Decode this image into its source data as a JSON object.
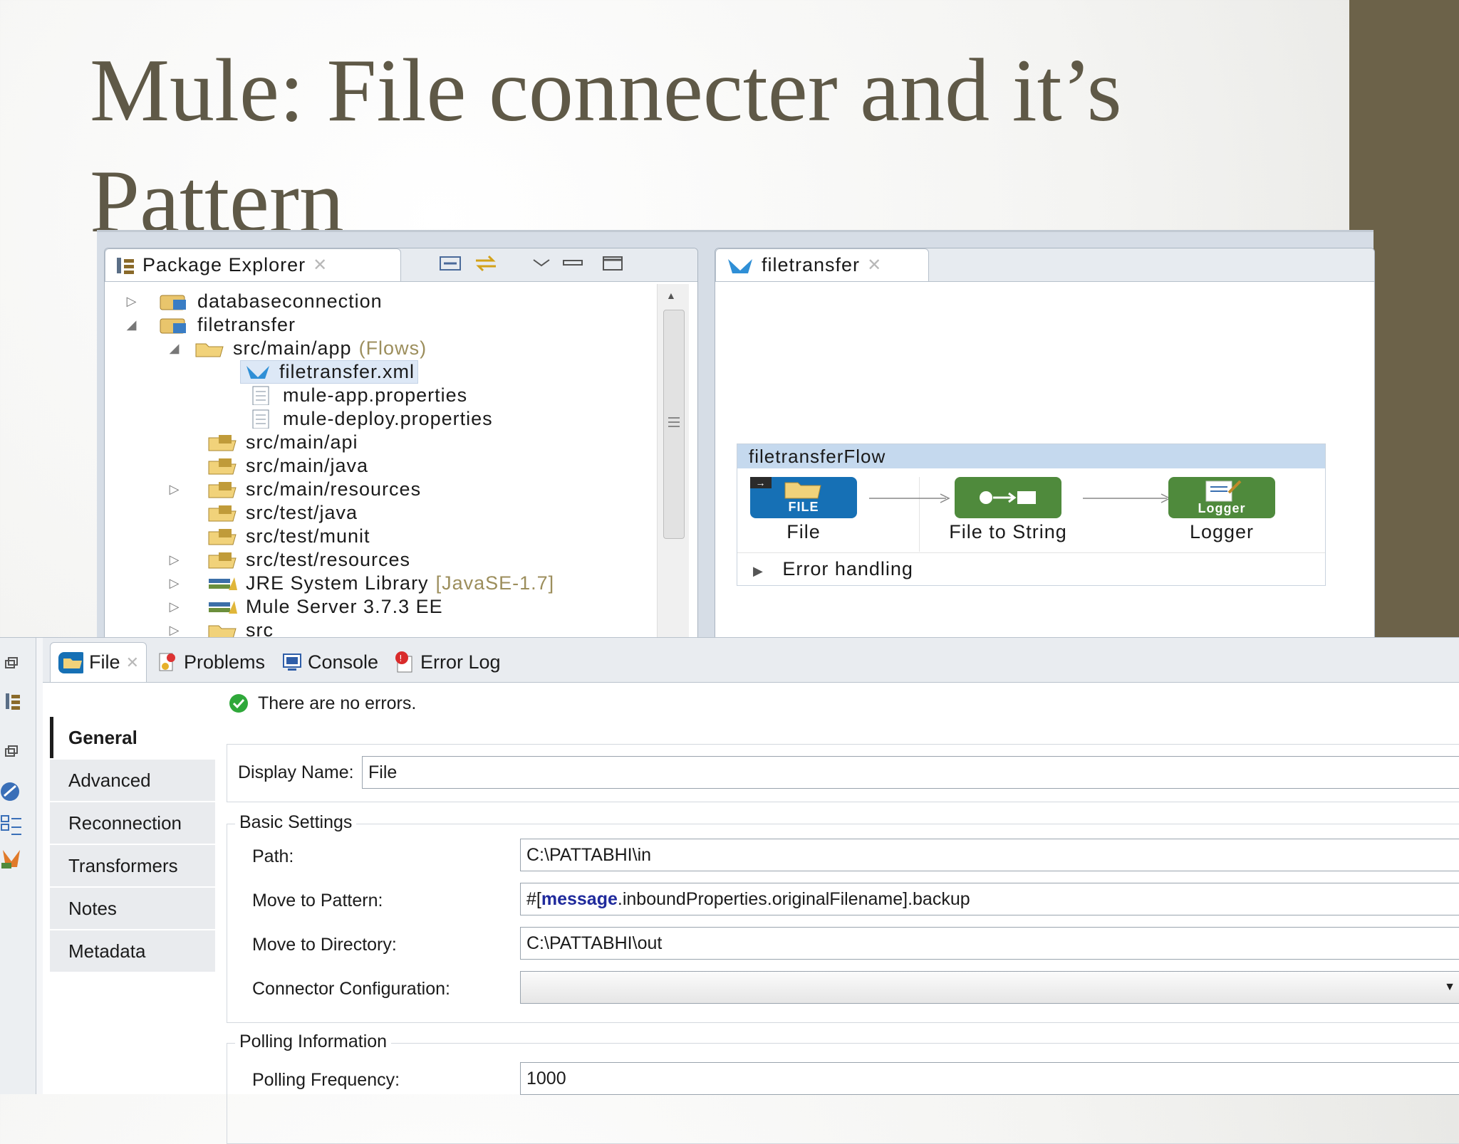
{
  "slide": {
    "title_line1": "Mule: File connecter and it’s",
    "title_line2": "Pattern"
  },
  "package_explorer": {
    "tab_label": "Package Explorer",
    "tree": [
      {
        "label": "databaseconnection",
        "suffix": ""
      },
      {
        "label": "filetransfer",
        "suffix": ""
      },
      {
        "label": "src/main/app",
        "suffix": "(Flows)"
      },
      {
        "label": "filetransfer.xml",
        "suffix": ""
      },
      {
        "label": "mule-app.properties",
        "suffix": ""
      },
      {
        "label": "mule-deploy.properties",
        "suffix": ""
      },
      {
        "label": "src/main/api",
        "suffix": ""
      },
      {
        "label": "src/main/java",
        "suffix": ""
      },
      {
        "label": "src/main/resources",
        "suffix": ""
      },
      {
        "label": "src/test/java",
        "suffix": ""
      },
      {
        "label": "src/test/munit",
        "suffix": ""
      },
      {
        "label": "src/test/resources",
        "suffix": ""
      },
      {
        "label": "JRE System Library",
        "suffix": "[JavaSE-1.7]"
      },
      {
        "label": "Mule Server 3.7.3 EE",
        "suffix": ""
      },
      {
        "label": "src",
        "suffix": ""
      }
    ]
  },
  "editor": {
    "tab_label": "filetransfer",
    "flow_name": "filetransferFlow",
    "nodes": [
      {
        "label": "File",
        "badge": "FILE"
      },
      {
        "label": "File to String",
        "badge": ""
      },
      {
        "label": "Logger",
        "badge": "Logger"
      }
    ],
    "error_handling": "Error handling"
  },
  "properties": {
    "tabs": [
      "File",
      "Problems",
      "Console",
      "Error Log"
    ],
    "status": "There are no errors.",
    "nav": [
      "General",
      "Advanced",
      "Reconnection",
      "Transformers",
      "Notes",
      "Metadata"
    ],
    "display_name_label": "Display Name:",
    "display_name_value": "File",
    "basic_settings_label": "Basic Settings",
    "path_label": "Path:",
    "path_value": "C:\\PATTABHI\\in",
    "move_to_pattern_label": "Move to Pattern:",
    "move_to_pattern_prefix": "#[",
    "move_to_pattern_keyword": "message",
    "move_to_pattern_rest": ".inboundProperties.originalFilename].backup",
    "move_to_directory_label": "Move to Directory:",
    "move_to_directory_value": "C:\\PATTABHI\\out",
    "connector_config_label": "Connector Configuration:",
    "connector_config_value": "",
    "polling_info_label": "Polling Information",
    "polling_frequency_label": "Polling Frequency:",
    "polling_frequency_value": "1000"
  },
  "colors": {
    "title_text": "#5f5947",
    "side_band": "#6c6249",
    "flow_header": "#c5d9ee",
    "file_node": "#1670b5",
    "transformer_node": "#4f8a3c",
    "status_ok": "#2fa83a"
  }
}
